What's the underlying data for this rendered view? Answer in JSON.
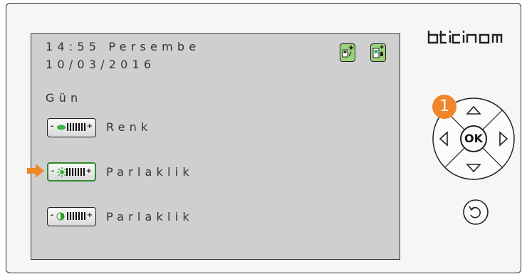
{
  "brand": "bticino",
  "screen": {
    "time_line": "14:55 Persembe",
    "date_line": "10/03/2016",
    "section_title": "Gün",
    "items": [
      {
        "label": "Renk",
        "icon": "color-drop-icon"
      },
      {
        "label": "Parlaklik",
        "icon": "sun-brightness-icon",
        "selected": true
      },
      {
        "label": "Parlaklik",
        "icon": "contrast-icon"
      }
    ]
  },
  "controls": {
    "ok_label": "OK",
    "step_badge": "1"
  },
  "colors": {
    "screen_bg": "#cfcfcf",
    "accent_green": "#2e8b2e",
    "badge_orange": "#f0862a"
  }
}
